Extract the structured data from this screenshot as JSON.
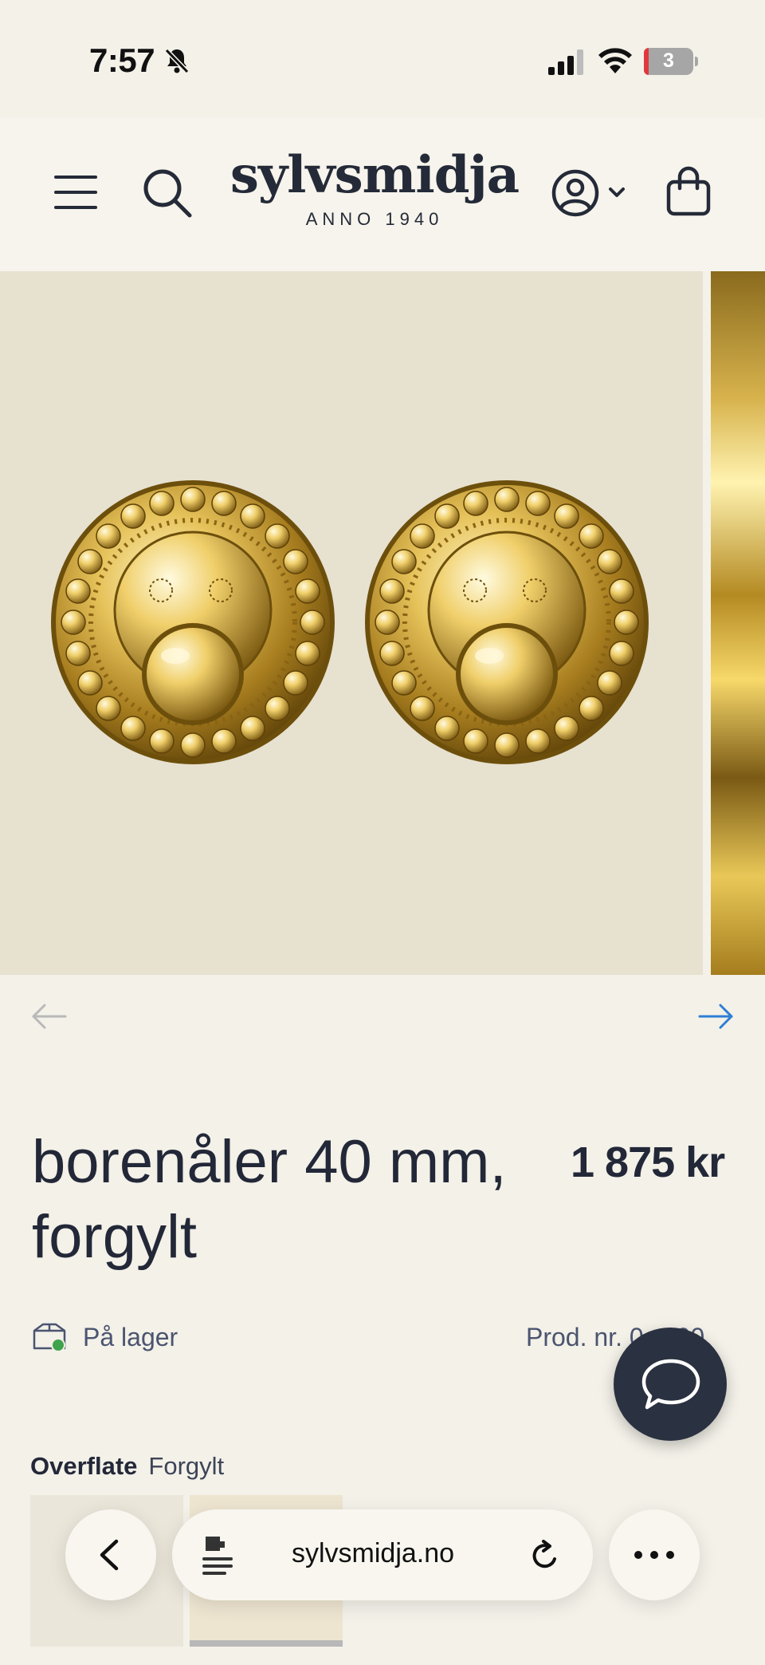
{
  "status_bar": {
    "time": "7:57",
    "battery_level": "3",
    "icons": [
      "bell-slash-icon",
      "signal-icon",
      "wifi-icon",
      "battery-icon"
    ]
  },
  "header": {
    "logo_name": "sylvsmidja",
    "logo_sub": "ANNO 1940",
    "icons": [
      "menu-icon",
      "search-icon",
      "account-icon",
      "chevron-down-icon",
      "cart-icon"
    ]
  },
  "gallery": {
    "prev_icon": "arrow-left-icon",
    "next_icon": "arrow-right-icon",
    "colors": {
      "background": "#e7e1d0",
      "next_arrow": "#2f7fd4",
      "prev_arrow": "#b9b9b9"
    }
  },
  "product": {
    "title": "borenåler 40 mm, forgylt",
    "price": "1 875 kr",
    "stock_label": "På lager",
    "product_number": "Prod. nr. 0… 00",
    "option_label": "Overflate",
    "option_value": "Forgylt"
  },
  "chat": {
    "icon": "chat-bubble-icon",
    "color": "#2a3140"
  },
  "browser": {
    "url": "sylvsmidja.no",
    "icons": [
      "back-icon",
      "reader-icon",
      "reload-icon",
      "more-icon"
    ]
  }
}
